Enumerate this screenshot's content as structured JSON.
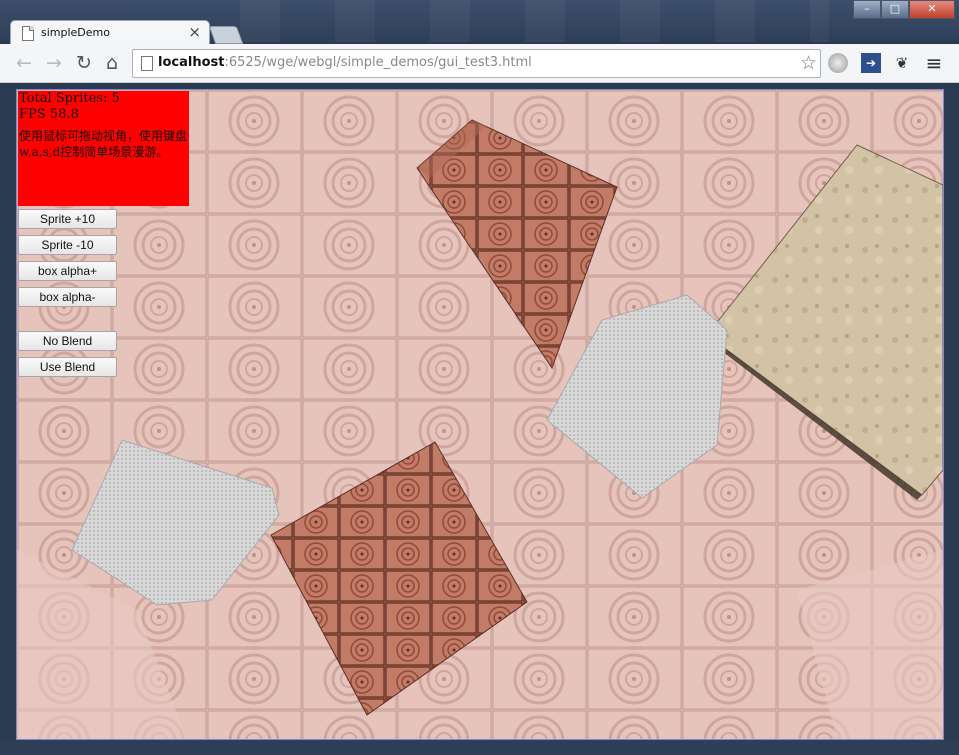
{
  "window": {
    "minimize": "–",
    "maximize": "□",
    "close": "✕"
  },
  "tab": {
    "title": "simpleDemo",
    "close_icon": "×"
  },
  "toolbar": {
    "back_icon": "←",
    "forward_icon": "→",
    "reload_icon": "↻",
    "home_icon": "⌂",
    "url_host": "localhost",
    "url_rest": ":6525/wge/webgl/simple_demos/gui_test3.html",
    "star_icon": "☆",
    "menu_icon": "≡"
  },
  "overlay": {
    "sprites": "Total Sprites: 5",
    "fps": "FPS 58.8",
    "message": "使用鼠标可拖动视角，使用键盘w,a,s,d控制简单场景漫游。"
  },
  "buttons": {
    "sprite_plus": "Sprite +10",
    "sprite_minus": "Sprite -10",
    "alpha_plus": "box alpha+",
    "alpha_minus": "box alpha-",
    "no_blend": "No Blend",
    "use_blend": "Use Blend"
  },
  "colors": {
    "overlay_bg": "#ff0000",
    "viewport_border": "#7a8bd0",
    "wood": "#c98a7c",
    "stone": "#cbb89a"
  }
}
